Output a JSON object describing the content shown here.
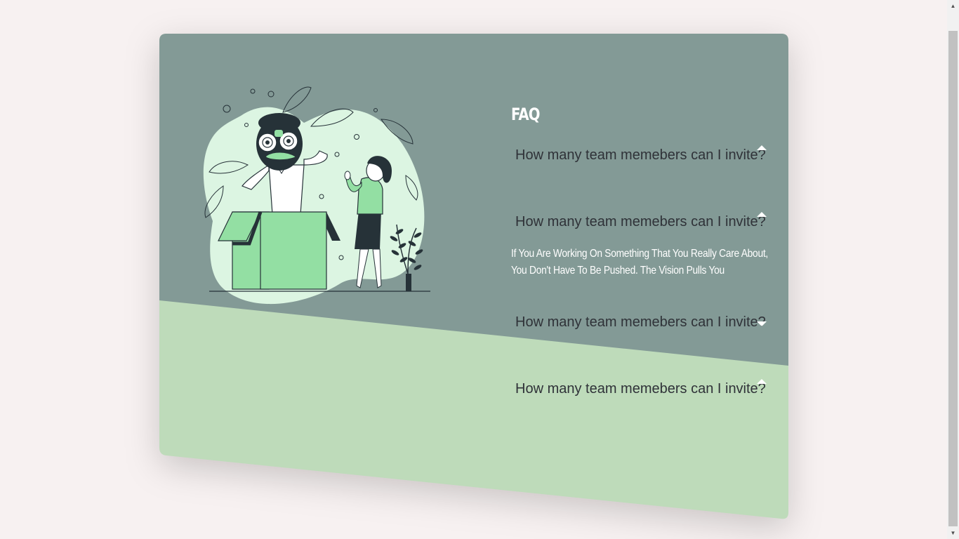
{
  "faq": {
    "title": "FAQ",
    "items": [
      {
        "question": "How many team memebers can I invite?",
        "expanded": false
      },
      {
        "question": "How many team memebers can I invite?",
        "expanded": true,
        "answer": "If You Are Working On Something That You Really Care About, You Don't Have To Be Pushed. The Vision Pulls You"
      },
      {
        "question": "How many team memebers can I invite?",
        "expanded": false
      },
      {
        "question": "How many team memebers can I invite?",
        "expanded": false
      }
    ]
  },
  "colors": {
    "page_background": "#f7f1f1",
    "card_top": "#839a96",
    "card_bottom": "#bedbba",
    "accent_green": "#93dfa3",
    "blob": "#dcf5e2",
    "ink": "#263238"
  },
  "icons": {
    "caret_up": "caret-up-icon",
    "caret_down": "caret-down-icon"
  }
}
